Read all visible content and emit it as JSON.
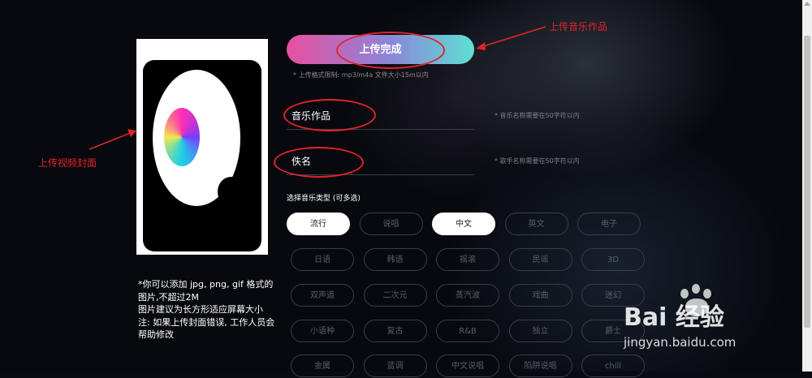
{
  "upload": {
    "button_label": "上传完成",
    "format_note": "* 上传格式限制: mp3/m4a 文件大小15m以内"
  },
  "cover": {
    "hint_lines": [
      "*你可以添加 jpg, png, gif 格式的",
      "图片,不超过2M",
      "图片建议为长方形适应屏幕大小",
      "注: 如果上传封面错误, 工作人员会",
      "帮助修改"
    ]
  },
  "fields": {
    "title_value": "音乐作品",
    "title_note": "* 音乐名称需要在50字符以内",
    "singer_value": "佚名",
    "singer_note": "* 歌手名称需要在50字符以内"
  },
  "music_type": {
    "label": "选择音乐类型 (可多选)",
    "tags": [
      {
        "label": "流行",
        "selected": true
      },
      {
        "label": "说唱",
        "selected": false
      },
      {
        "label": "中文",
        "selected": true
      },
      {
        "label": "英文",
        "selected": false
      },
      {
        "label": "电子",
        "selected": false
      },
      {
        "label": "日语",
        "selected": false
      },
      {
        "label": "韩语",
        "selected": false
      },
      {
        "label": "摇滚",
        "selected": false
      },
      {
        "label": "民谣",
        "selected": false
      },
      {
        "label": "3D",
        "selected": false
      },
      {
        "label": "双声道",
        "selected": false
      },
      {
        "label": "二次元",
        "selected": false
      },
      {
        "label": "蒸汽波",
        "selected": false
      },
      {
        "label": "戏曲",
        "selected": false
      },
      {
        "label": "迷幻",
        "selected": false
      },
      {
        "label": "小语种",
        "selected": false
      },
      {
        "label": "复古",
        "selected": false
      },
      {
        "label": "R&B",
        "selected": false
      },
      {
        "label": "独立",
        "selected": false
      },
      {
        "label": "爵士",
        "selected": false
      },
      {
        "label": "金属",
        "selected": false
      },
      {
        "label": "蓝调",
        "selected": false
      },
      {
        "label": "中文说唱",
        "selected": false
      },
      {
        "label": "陷阱说唱",
        "selected": false
      },
      {
        "label": "chill",
        "selected": false
      }
    ]
  },
  "annotations": {
    "upload_music": "上传音乐作品",
    "upload_cover": "上传视频封面",
    "color": "#e0232a"
  },
  "watermark": {
    "brand": "Bai  经验",
    "url": "jingyan.baidu.com"
  }
}
